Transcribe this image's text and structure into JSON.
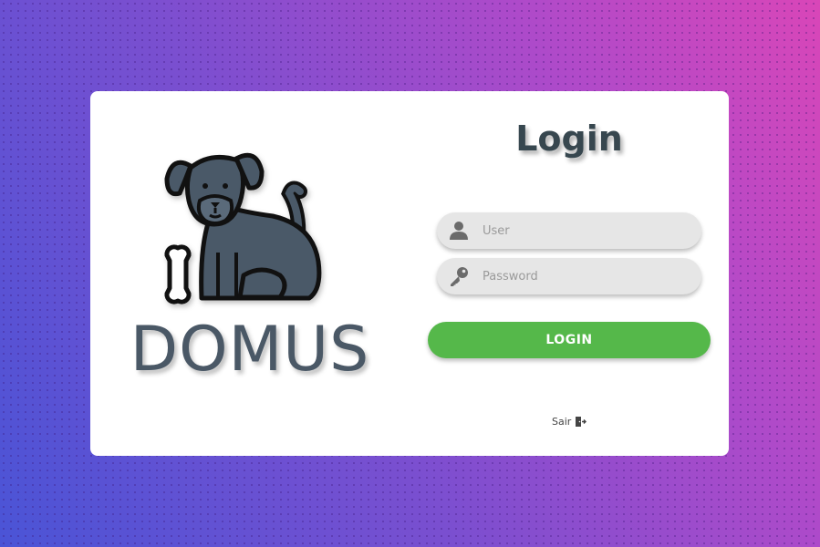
{
  "brand": {
    "name": "DOMUS",
    "logo_icon": "dog-with-bone-icon"
  },
  "login_form": {
    "title": "Login",
    "user_field": {
      "placeholder": "User",
      "value": "",
      "icon": "user-icon"
    },
    "password_field": {
      "placeholder": "Password",
      "value": "",
      "icon": "key-icon"
    },
    "submit_label": "LOGIN",
    "exit_label": "Sair",
    "exit_icon": "door-exit-icon"
  },
  "colors": {
    "primary_button": "#55b84a",
    "text_dark": "#37474f",
    "field_background": "#e6e6e6",
    "background_gradient_start": "#4a54d6",
    "background_gradient_end": "#d946b8"
  }
}
